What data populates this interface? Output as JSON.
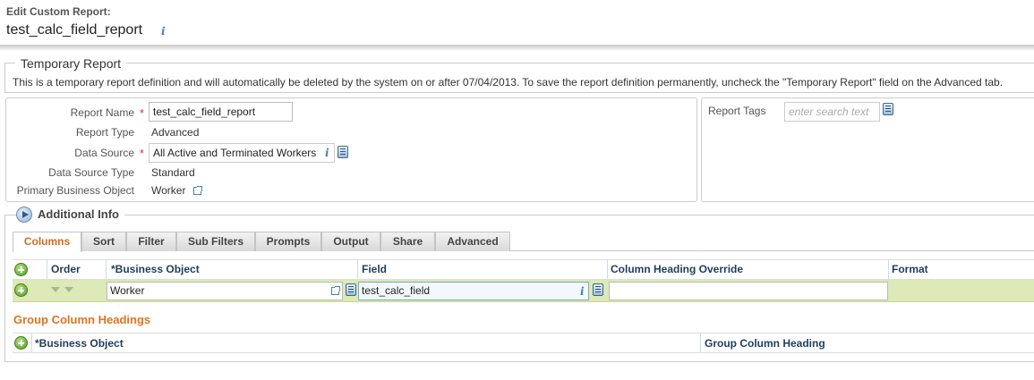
{
  "header": {
    "subtitle": "Edit Custom Report:",
    "title": "test_calc_field_report",
    "info_icon": "info-icon"
  },
  "temporary": {
    "legend": "Temporary Report",
    "message": "This is a temporary report definition and will automatically be deleted by the system on or after 07/04/2013. To save the report definition permanently, uncheck the \"Temporary Report\" field on the Advanced tab."
  },
  "fields": {
    "report_name_label": "Report Name",
    "report_name_value": "test_calc_field_report",
    "report_type_label": "Report Type",
    "report_type_value": "Advanced",
    "data_source_label": "Data Source",
    "data_source_value": "All Active and Terminated Workers",
    "data_source_type_label": "Data Source Type",
    "data_source_type_value": "Standard",
    "primary_bo_label": "Primary Business Object",
    "primary_bo_value": "Worker",
    "required_marker": "*"
  },
  "tags": {
    "label": "Report Tags",
    "placeholder": "enter search text"
  },
  "additional": {
    "title": "Additional Info"
  },
  "tabs": [
    {
      "label": "Columns"
    },
    {
      "label": "Sort"
    },
    {
      "label": "Filter"
    },
    {
      "label": "Sub Filters"
    },
    {
      "label": "Prompts"
    },
    {
      "label": "Output"
    },
    {
      "label": "Share"
    },
    {
      "label": "Advanced"
    }
  ],
  "columns_grid": {
    "headers": {
      "order": "Order",
      "business_object": "*Business Object",
      "field": "Field",
      "heading_override": "Column Heading Override",
      "format": "Format"
    },
    "row": {
      "business_object": "Worker",
      "field": "test_calc_field",
      "heading_override": ""
    }
  },
  "group_headings": {
    "title": "Group Column Headings",
    "headers": {
      "business_object": "*Business Object",
      "group_heading": "Group Column Heading"
    }
  },
  "colors": {
    "active_tab": "#d56a1d",
    "row_highlight": "#dde9b6",
    "section_title": "#e0741e",
    "add_icon": "#4f9a1d"
  }
}
